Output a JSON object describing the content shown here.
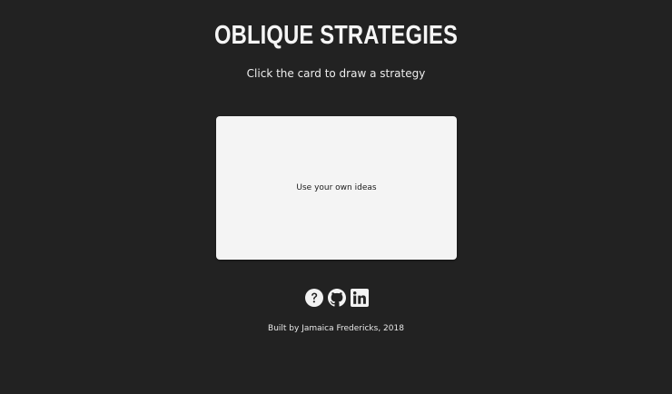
{
  "header": {
    "title": "OBLIQUE STRATEGIES",
    "subtitle": "Click the card to draw a strategy"
  },
  "card": {
    "strategy": "Use your own ideas"
  },
  "links": [
    {
      "icon": "question-circle-icon"
    },
    {
      "icon": "github-icon"
    },
    {
      "icon": "linkedin-icon"
    }
  ],
  "footer": {
    "credit": "Built by Jamaica Fredericks, 2018"
  },
  "colors": {
    "background": "#222222",
    "card": "#f4f4f4",
    "text": "#f2f2f2"
  }
}
